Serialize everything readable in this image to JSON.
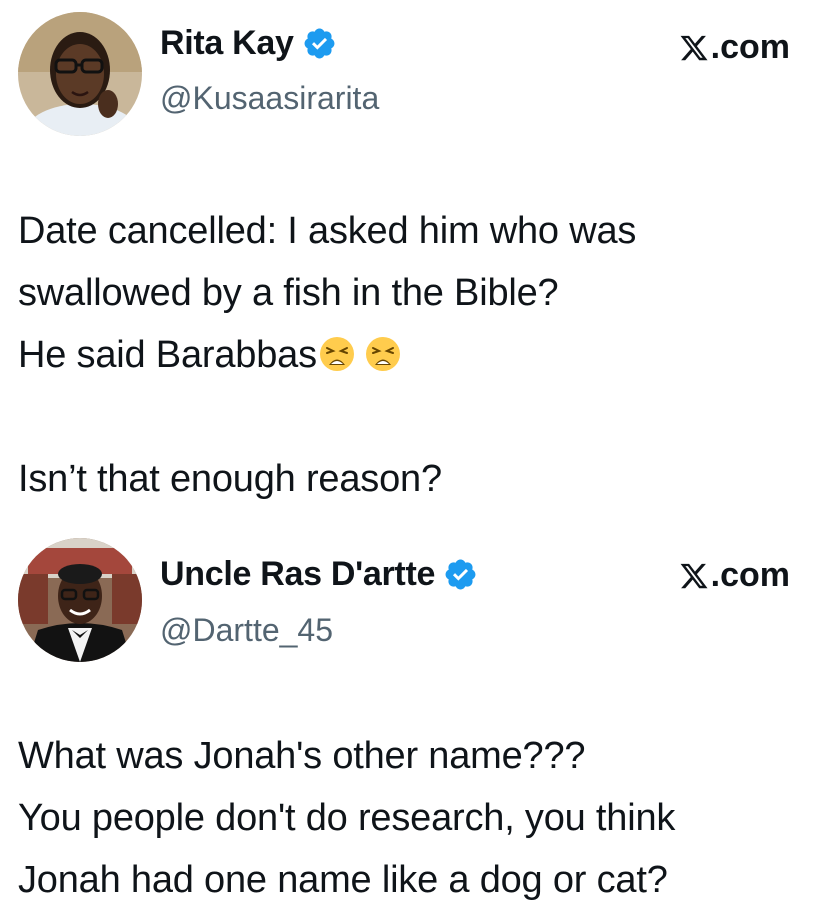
{
  "tweets": [
    {
      "display_name": "Rita Kay",
      "handle": "@Kusaasirarita",
      "source": ".com",
      "verified_icon": "verified-badge-icon",
      "lines": [
        "Date cancelled: I asked him who was",
        "swallowed by a fish in the Bible?",
        "He said Barabbas",
        "",
        "Isn’t that enough reason?"
      ],
      "emoji_after_line_3": [
        "weary-face-icon",
        "weary-face-icon"
      ]
    },
    {
      "display_name": "Uncle Ras D'artte",
      "handle": "@Dartte_45",
      "source": ".com",
      "verified_icon": "verified-badge-icon",
      "lines": [
        "What was Jonah's other name???",
        "You people don't do research, you think",
        "Jonah had one name like a dog or cat?"
      ]
    }
  ],
  "colors": {
    "text": "#0f1419",
    "secondary_text": "#536471",
    "verified_blue": "#1d9bf0",
    "background": "#ffffff"
  }
}
